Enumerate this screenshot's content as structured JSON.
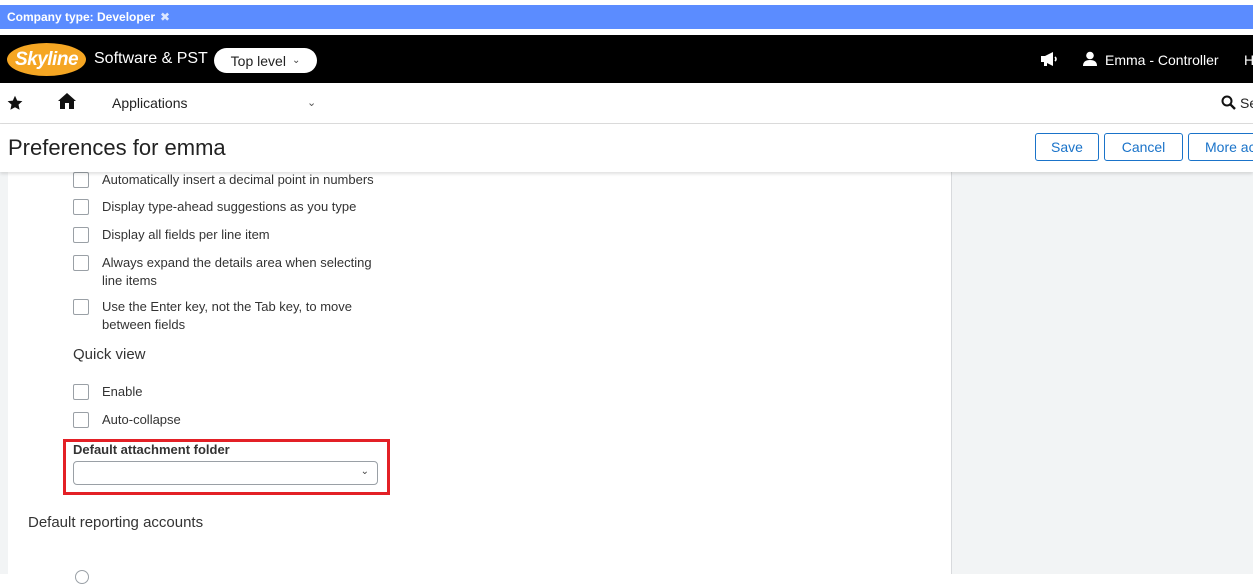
{
  "company_bar": {
    "label": "Company type: Developer",
    "remove_icon": "close-icon"
  },
  "header": {
    "logo_text": "Skyline",
    "company_name": "Software & PST",
    "level_selector": "Top level",
    "user_name": "Emma - Controller",
    "help_partial": "H"
  },
  "nav": {
    "applications_label": "Applications",
    "search_partial": "Se"
  },
  "title_bar": {
    "title": "Preferences for emma",
    "save_label": "Save",
    "cancel_label": "Cancel",
    "more_label": "More ac"
  },
  "preferences": {
    "checkboxes": [
      {
        "label": "Automatically insert a decimal point in numbers",
        "checked": false
      },
      {
        "label": "Display type-ahead suggestions as you type",
        "checked": false
      },
      {
        "label": "Display all fields per line item",
        "checked": false
      },
      {
        "label": "Always expand the details area when selecting line items",
        "checked": false
      },
      {
        "label": "Use the Enter key, not the Tab key, to move between fields",
        "checked": false
      }
    ],
    "quick_view": {
      "heading": "Quick view",
      "options": [
        {
          "label": "Enable",
          "checked": false
        },
        {
          "label": "Auto-collapse",
          "checked": false
        }
      ]
    },
    "default_attachment_folder": {
      "label": "Default attachment folder",
      "value": ""
    },
    "default_reporting_accounts": {
      "heading": "Default reporting accounts"
    }
  },
  "colors": {
    "company_bar": "#5b8cff",
    "header_bg": "#000000",
    "logo_orange": "#f5a623",
    "accent_blue": "#1a73c9",
    "highlight_red": "#e32026"
  }
}
